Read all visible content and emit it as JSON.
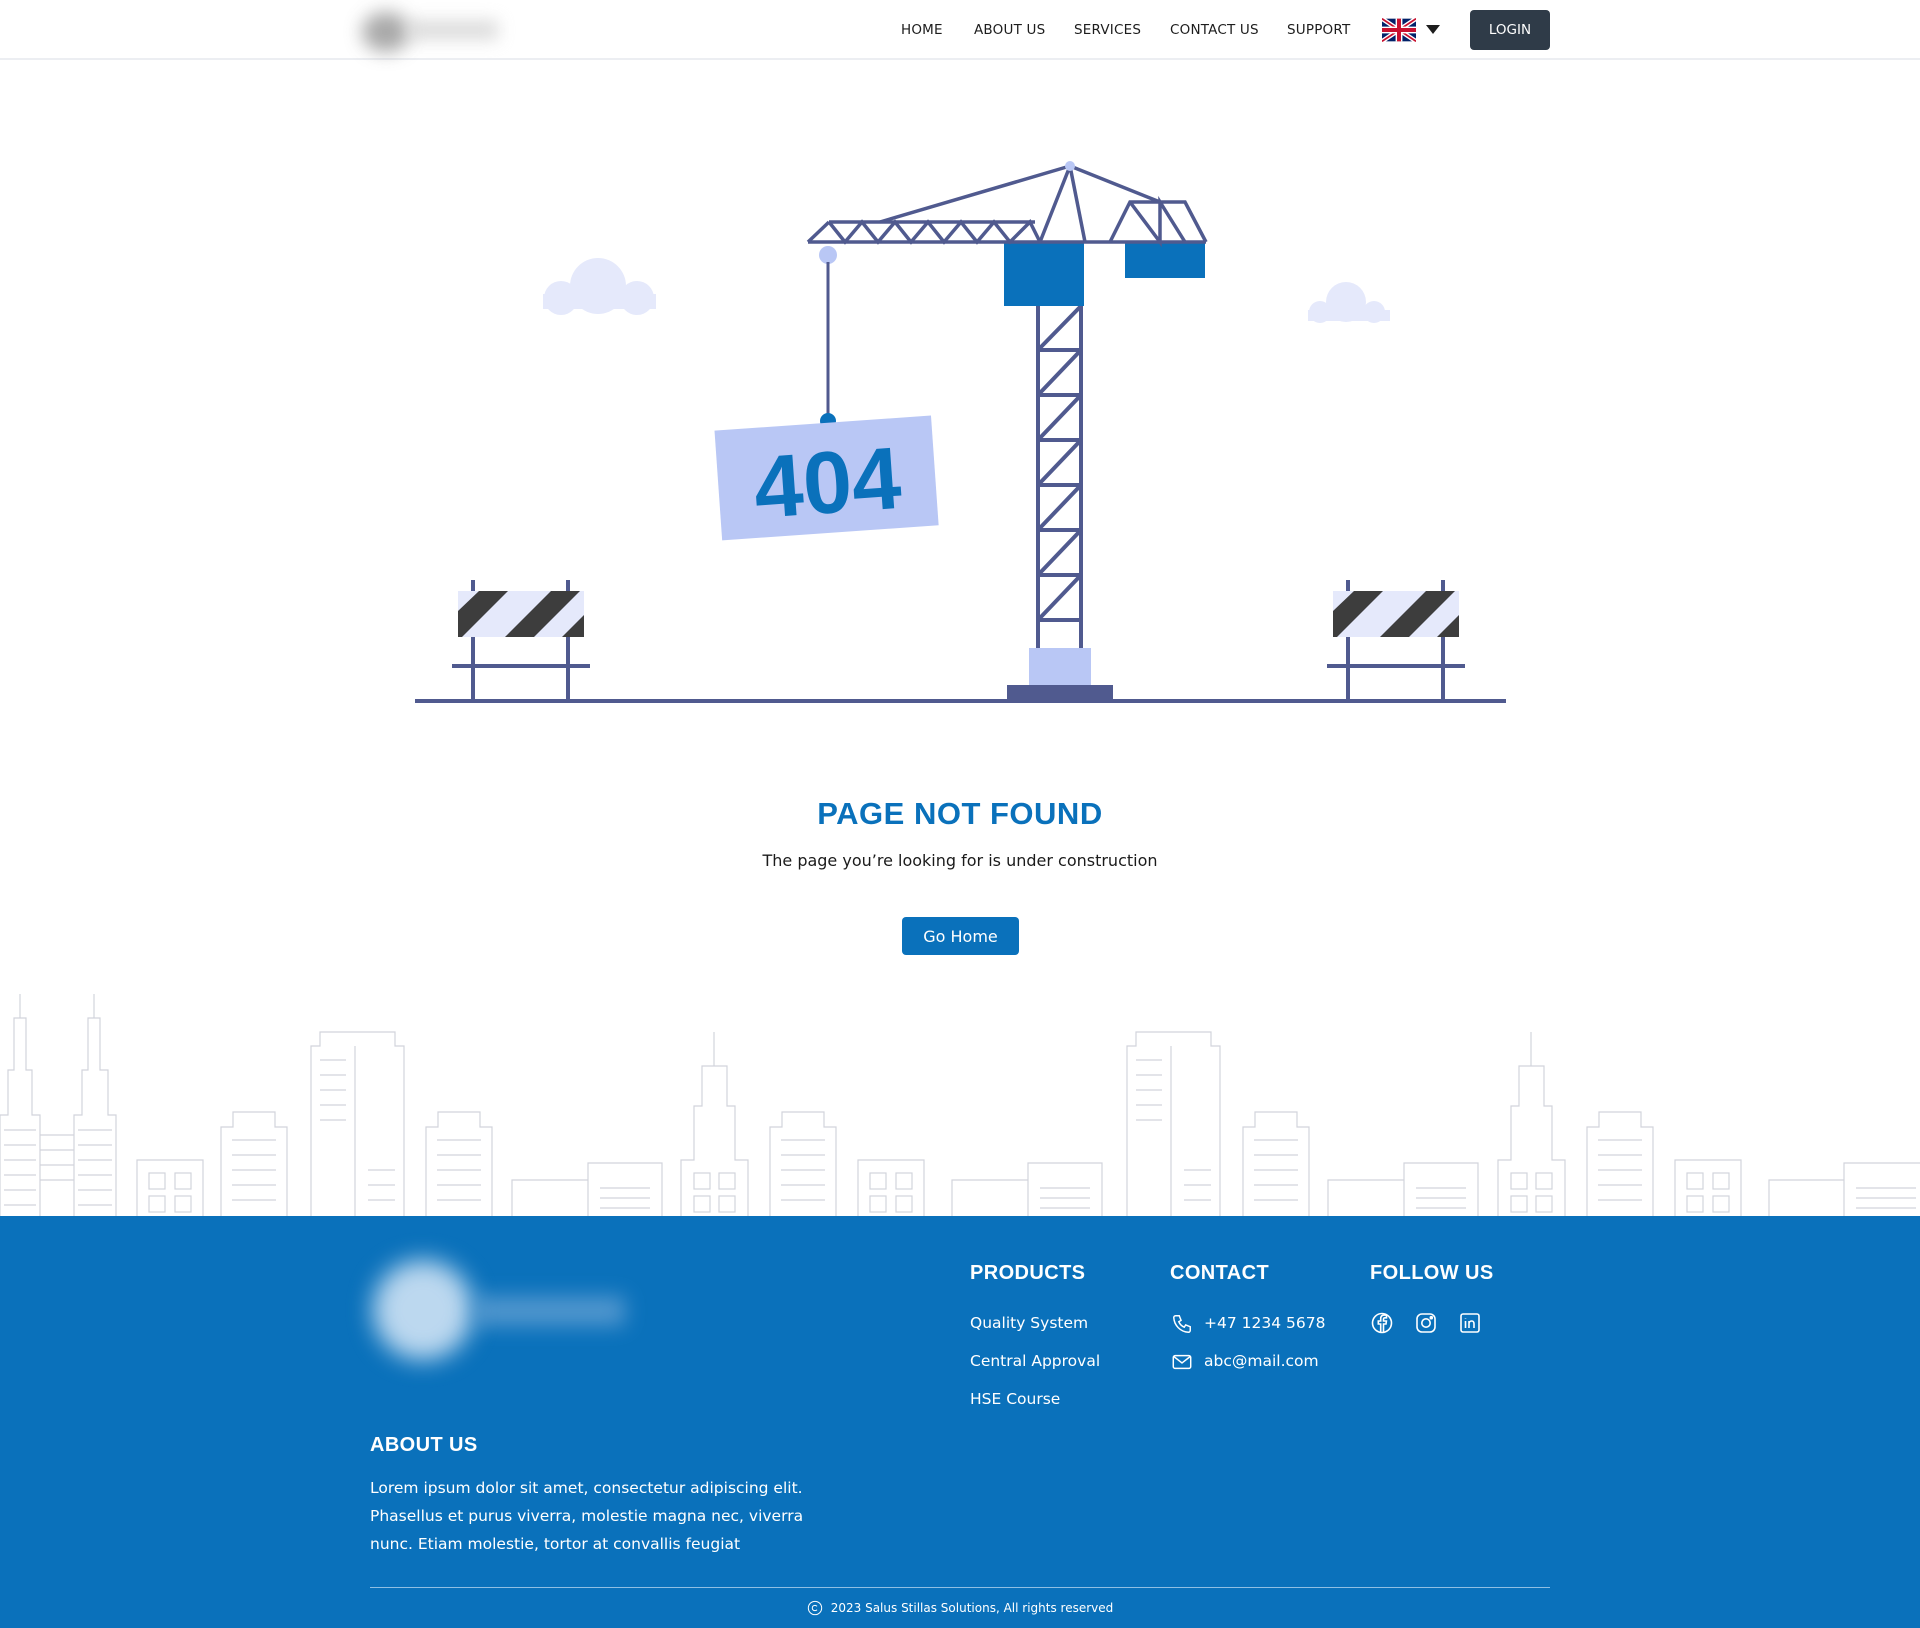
{
  "header": {
    "nav": [
      "HOME",
      "ABOUT US",
      "SERVICES",
      "CONTACT US",
      "SUPPORT"
    ],
    "language_flag": "uk-flag-icon",
    "login_label": "LOGIN"
  },
  "illustration": {
    "sign_text": "404"
  },
  "main": {
    "title": "PAGE NOT FOUND",
    "subtitle": "The page you’re looking for is under construction",
    "button_label": "Go Home"
  },
  "footer": {
    "products_heading": "PRODUCTS",
    "products": [
      "Quality System",
      "Central Approval",
      "HSE Course"
    ],
    "contact_heading": "CONTACT",
    "phone": "+47 1234 5678",
    "email": "abc@mail.com",
    "follow_heading": "FOLLOW US",
    "social_icons": [
      "facebook-icon",
      "instagram-icon",
      "linkedin-icon"
    ],
    "about_heading": "ABOUT US",
    "about_text": "Lorem ipsum dolor sit amet, consectetur adipiscing elit. Phasellus et purus viverra, molestie magna nec, viverra nunc. Etiam molestie, tortor at convallis feugiat",
    "copyright": "2023 Salus Stillas Solutions, All rights reserved"
  },
  "colors": {
    "primary": "#0a71bb",
    "login_bg": "#2f3b48",
    "crane_stroke": "#505a8f",
    "sign_bg": "#b9c7f5"
  }
}
